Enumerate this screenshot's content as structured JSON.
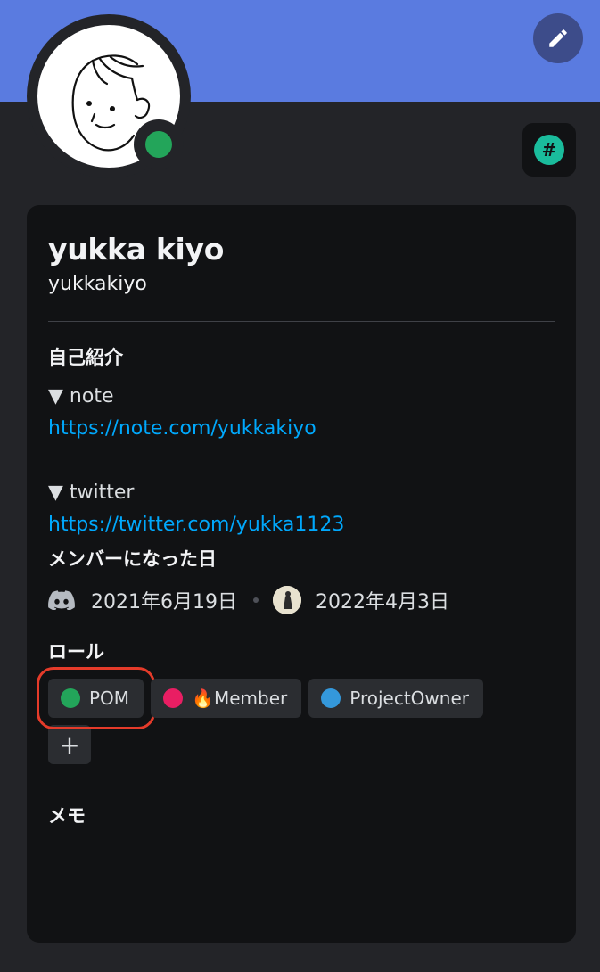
{
  "profile": {
    "display_name": "yukka kiyo",
    "username": "yukkakiyo",
    "status": "online",
    "banner_color": "#5a7be0"
  },
  "about": {
    "title": "自己紹介",
    "line1": "▼ note",
    "link1": "https://note.com/yukkakiyo",
    "line2": "▼ twitter",
    "link2": "https://twitter.com/yukka1123"
  },
  "member_since": {
    "title": "メンバーになった日",
    "discord_date": "2021年6月19日",
    "server_date": "2022年4月3日"
  },
  "roles": {
    "title": "ロール",
    "items": [
      {
        "label": "POM",
        "color": "#23a55a"
      },
      {
        "label": "🔥Member",
        "color": "#e91e63"
      },
      {
        "label": "ProjectOwner",
        "color": "#3498db"
      }
    ],
    "add_label": "+"
  },
  "memo": {
    "title": "メモ"
  },
  "icons": {
    "edit": "pencil-icon",
    "badge": "hashtag-badge-icon",
    "discord": "discord-icon",
    "badge_symbol": "#"
  }
}
